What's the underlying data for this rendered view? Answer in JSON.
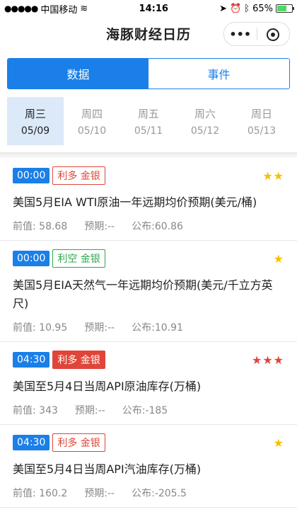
{
  "status": {
    "carrier": "中国移动",
    "time": "14:16",
    "battery": "65%"
  },
  "nav": {
    "title": "海豚财经日历",
    "more": "•••"
  },
  "tabs": [
    {
      "label": "数据"
    },
    {
      "label": "事件"
    }
  ],
  "days": [
    {
      "name": "周三",
      "date": "05/09"
    },
    {
      "name": "周四",
      "date": "05/10"
    },
    {
      "name": "周五",
      "date": "05/11"
    },
    {
      "name": "周六",
      "date": "05/12"
    },
    {
      "name": "周日",
      "date": "05/13"
    }
  ],
  "labels": {
    "prev": "前值:",
    "forecast": "预期:",
    "actual": "公布:"
  },
  "items": [
    {
      "time": "00:00",
      "tag": "利多 金银",
      "stars": "★★",
      "title": "美国5月EIA WTI原油一年远期均价预期(美元/桶)",
      "prev": "58.68",
      "forecast": "--",
      "actual": "60.86"
    },
    {
      "time": "00:00",
      "tag": "利空 金银",
      "stars": "★",
      "title": "美国5月EIA天然气一年远期均价预期(美元/千立方英尺)",
      "prev": "10.95",
      "forecast": "--",
      "actual": "10.91"
    },
    {
      "time": "04:30",
      "tag": "利多 金银",
      "stars": "★★★",
      "title": "美国至5月4日当周API原油库存(万桶)",
      "prev": "343",
      "forecast": "--",
      "actual": "-185"
    },
    {
      "time": "04:30",
      "tag": "利多 金银",
      "stars": "★",
      "title": "美国至5月4日当周API汽油库存(万桶)",
      "prev": "160.2",
      "forecast": "--",
      "actual": "-205.5"
    }
  ]
}
